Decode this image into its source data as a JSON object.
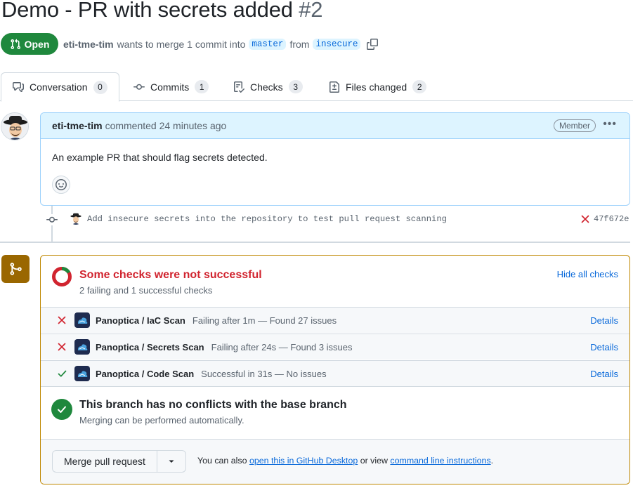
{
  "pr": {
    "title": "Demo - PR with secrets added",
    "number": "#2",
    "state": "Open",
    "author": "eti-tme-tim",
    "merge_text": "wants to merge 1 commit into",
    "base_branch": "master",
    "from_text": "from",
    "head_branch": "insecure"
  },
  "tabs": [
    {
      "label": "Conversation",
      "count": "0",
      "icon": "comment-discussion-icon"
    },
    {
      "label": "Commits",
      "count": "1",
      "icon": "git-commit-icon"
    },
    {
      "label": "Checks",
      "count": "3",
      "icon": "checklist-icon"
    },
    {
      "label": "Files changed",
      "count": "2",
      "icon": "file-diff-icon"
    }
  ],
  "comment": {
    "author": "eti-tme-tim",
    "action": "commented 24 minutes ago",
    "role": "Member",
    "body": "An example PR that should flag secrets detected."
  },
  "commit": {
    "message": "Add insecure secrets into the repository to test pull request scanning",
    "sha": "47f672e",
    "status": "failed"
  },
  "checks": {
    "title": "Some checks were not successful",
    "subtitle": "2 failing and 1 successful checks",
    "hide_label": "Hide all checks",
    "failing": 2,
    "successful": 1,
    "items": [
      {
        "name": "Panoptica / IaC Scan",
        "desc": "Failing after 1m — Found 27 issues",
        "status": "fail",
        "details": "Details"
      },
      {
        "name": "Panoptica / Secrets Scan",
        "desc": "Failing after 24s — Found 3 issues",
        "status": "fail",
        "details": "Details"
      },
      {
        "name": "Panoptica / Code Scan",
        "desc": "Successful in 31s — No issues",
        "status": "success",
        "details": "Details"
      }
    ]
  },
  "conflicts": {
    "title": "This branch has no conflicts with the base branch",
    "subtitle": "Merging can be performed automatically."
  },
  "merge": {
    "button": "Merge pull request",
    "note_prefix": "You can also",
    "desktop_link": "open this in GitHub Desktop",
    "or_view": "or view",
    "cli_link": "command line instructions",
    "period": "."
  },
  "colors": {
    "open_green": "#1f883d",
    "fail_red": "#d1242f",
    "link_blue": "#0969da",
    "warning_brown": "#9a6700"
  }
}
